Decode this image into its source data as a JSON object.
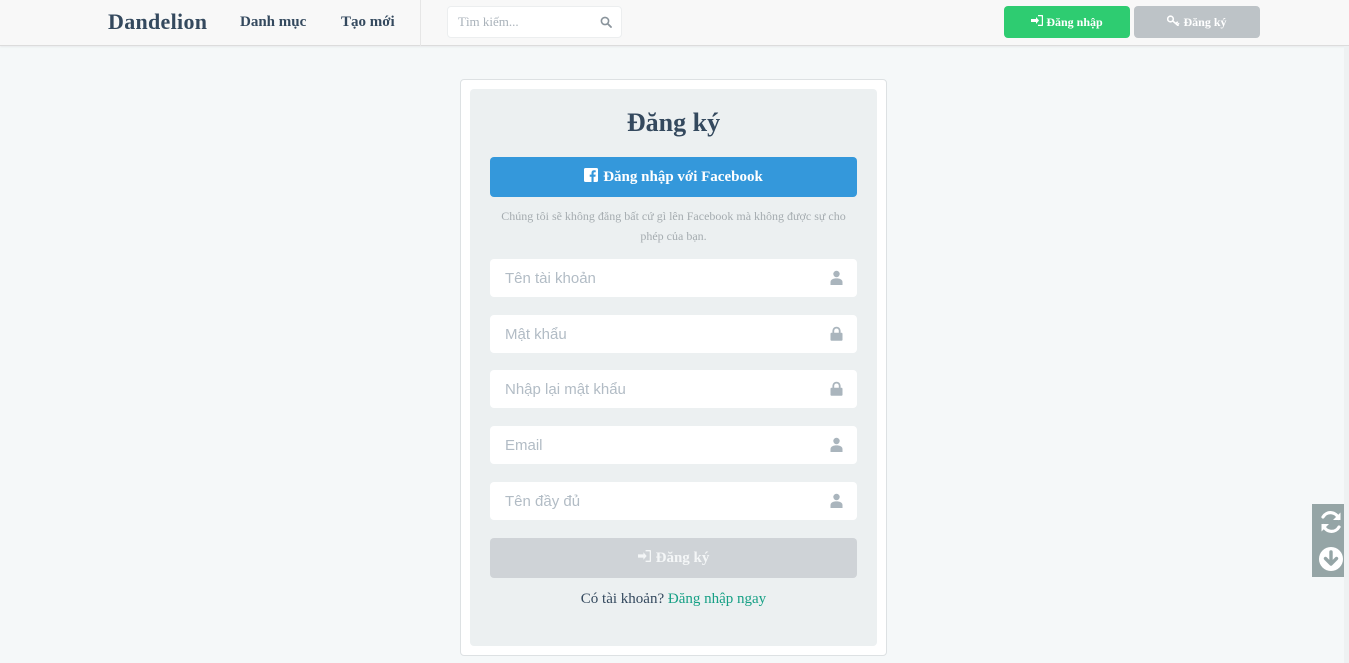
{
  "navbar": {
    "brand": "Dandelion",
    "links": [
      {
        "label": "Danh mục"
      },
      {
        "label": "Tạo mới"
      }
    ],
    "search": {
      "placeholder": "Tìm kiếm..."
    },
    "login_label": "Đăng nhập",
    "register_label": "Đăng ký"
  },
  "form": {
    "title": "Đăng ký",
    "facebook_button": "Đăng nhập với Facebook",
    "facebook_note": "Chúng tôi sẽ không đăng bất cứ gì lên Facebook mà không được sự cho phép của bạn.",
    "fields": [
      {
        "placeholder": "Tên tài khoản",
        "icon": "user-icon"
      },
      {
        "placeholder": "Mật khẩu",
        "icon": "lock-icon"
      },
      {
        "placeholder": "Nhập lại mật khẩu",
        "icon": "lock-icon"
      },
      {
        "placeholder": "Email",
        "icon": "user-icon"
      },
      {
        "placeholder": "Tên đầy đủ",
        "icon": "user-icon"
      }
    ],
    "submit_label": "Đăng ký",
    "have_account_text": "Có tài khoản?",
    "login_now_link": "Đăng nhập ngay"
  },
  "side_widget": {
    "icons": [
      "refresh-icon",
      "arrow-down-circle-icon"
    ]
  },
  "colors": {
    "brand_text": "#34495e",
    "login_green": "#2ecc71",
    "register_gray": "#bdc3c7",
    "facebook_blue": "#3498db",
    "link_teal": "#16a085",
    "card_bg": "#ecf0f1"
  }
}
